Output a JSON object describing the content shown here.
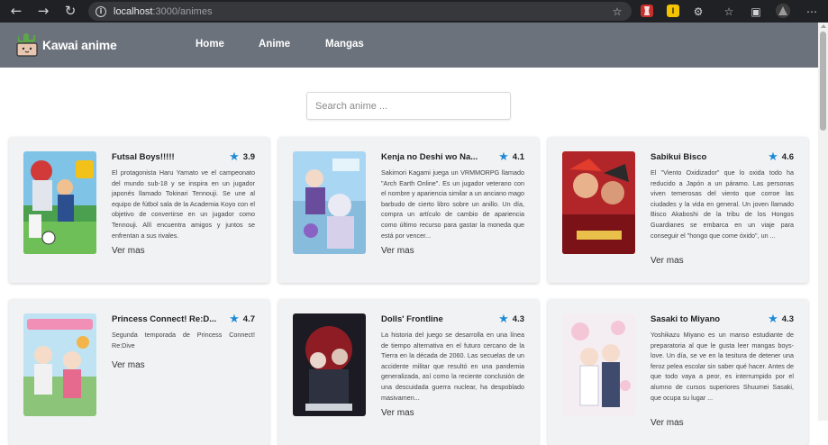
{
  "browser": {
    "url_host": "localhost",
    "url_path": ":3000/animes"
  },
  "header": {
    "brand": "Kawai anime",
    "nav": [
      "Home",
      "Anime",
      "Mangas"
    ]
  },
  "search": {
    "placeholder": "Search anime ..."
  },
  "cards": [
    {
      "title": "Futsal Boys!!!!!",
      "rating": "3.9",
      "synopsis": "El protagonista Haru Yamato ve el campeonato del mundo sub-18 y se inspira en un jugador japonés llamado Tokinari Tennouji. Se une al equipo de fútbol sala de la Academia Koyo con el objetivo de convertirse en un jugador como Tennouji. Allí encuentra amigos y juntos se enfrentan a sus rivales.",
      "link": "Ver mas"
    },
    {
      "title": "Kenja no Deshi wo Na...",
      "rating": "4.1",
      "synopsis": "Sakimori Kagami juega un VRMMORPG llamado \"Arch Earth Online\". Es un jugador veterano con el nombre y apariencia similar a un anciano mago barbudo de cierto libro sobre un anillo. Un día, compra un artículo de cambio de apariencia como último recurso para gastar la moneda que está por vencer...",
      "link": "Ver mas"
    },
    {
      "title": "Sabikui Bisco",
      "rating": "4.6",
      "synopsis": "El \"Viento Oxidizador\" que lo oxida todo ha reducido a Japón a un páramo. Las personas viven temerosas del viento que corroe las ciudades y la vida en general. Un joven llamado Bisco Akaboshi de la tribu de los Hongos Guardianes se embarca en un viaje para conseguir el \"hongo que come óxido\", un ...",
      "link": "Ver mas"
    },
    {
      "title": "Princess Connect! Re:D...",
      "rating": "4.7",
      "synopsis": "Segunda temporada de Princess Connect! Re:Dive",
      "link": "Ver mas"
    },
    {
      "title": "Dolls' Frontline",
      "rating": "4.3",
      "synopsis": "La historia del juego se desarrolla en una línea de tiempo alternativa en el futuro cercano de la Tierra en la década de 2060. Las secuelas de un accidente militar que resultó en una pandemia generalizada, así como la reciente conclusión de una descuidada guerra nuclear, ha despoblado masivamen...",
      "link": "Ver mas"
    },
    {
      "title": "Sasaki to Miyano",
      "rating": "4.3",
      "synopsis": "Yoshikazu Miyano es un manso estudiante de preparatoria al que le gusta leer mangas boys-love. Un día, se ve en la tesitura de detener una feroz pelea escolar sin saber qué hacer. Antes de que todo vaya a peor, es interrumpido por el alumno de cursos superiores Shuumei Sasaki, que ocupa su lugar ...",
      "link": "Ver mas"
    }
  ]
}
